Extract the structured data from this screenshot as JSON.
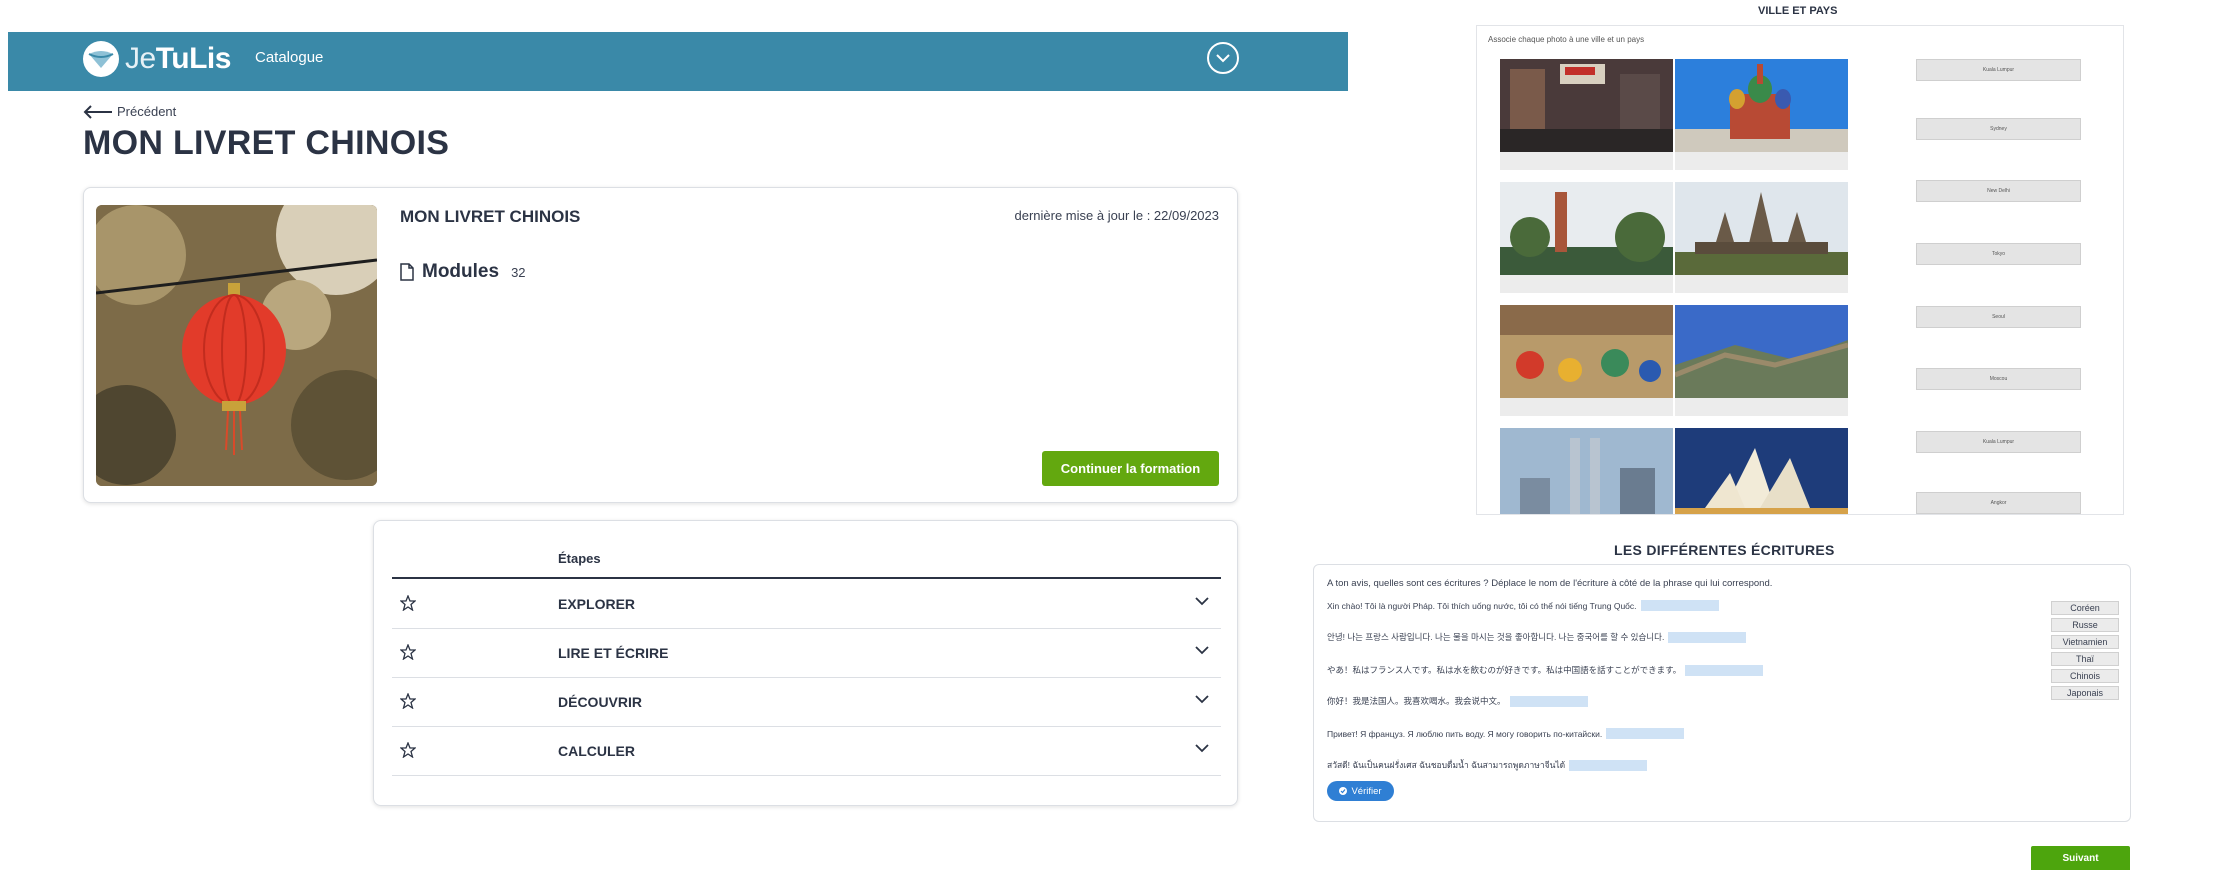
{
  "header": {
    "logo_prefix": "Je",
    "logo_brand": "TuLis",
    "nav_catalogue": "Catalogue",
    "toggle_icon": "chevron-down-circle-icon"
  },
  "page": {
    "back_label": "Précédent",
    "title": "MON LIVRET CHINOIS"
  },
  "course": {
    "name": "MON LIVRET CHINOIS",
    "updated": "dernière mise à jour le : 22/09/2023",
    "modules_label": "Modules",
    "modules_count": "32",
    "continue_label": "Continuer la formation"
  },
  "steps": {
    "header": "Étapes",
    "items": [
      {
        "label": "EXPLORER"
      },
      {
        "label": "LIRE ET ÉCRIRE"
      },
      {
        "label": "DÉCOUVRIR"
      },
      {
        "label": "CALCULER"
      }
    ]
  },
  "ville_pays": {
    "title": "VILLE ET PAYS",
    "instruction": "Associe chaque photo à une ville et un pays",
    "cities": [
      "Kuala Lumpur",
      "Sydney",
      "New Delhi",
      "Tokyo",
      "Seoul",
      "Moscou",
      "Kuala Lumpur",
      "Angkor"
    ]
  },
  "ecritures": {
    "title": "LES DIFFÉRENTES ÉCRITURES",
    "instruction": "A ton avis, quelles sont ces écritures ? Déplace le nom de l'écriture à côté de la phrase qui lui correspond.",
    "sentences": [
      "Xin chào! Tôi là người Pháp. Tôi thích uống nước, tôi có thể nói tiếng Trung Quốc.",
      "안녕! 나는 프랑스 사람입니다. 나는 물을 마시는 것을 좋아합니다. 나는 중국어를 할 수 있습니다.",
      "やあ！私はフランス人です。私は水を飲むのが好きです。私は中国語を話すことができます。",
      "你好！我是法国人。我喜欢喝水。我会说中文。",
      "Привет! Я француз. Я люблю пить воду. Я могу говорить по-китайски.",
      "สวัสดี! ฉันเป็นคนฝรั่งเศส ฉันชอบดื่มน้ำ ฉันสามารถพูดภาษาจีนได้"
    ],
    "chips": [
      "Coréen",
      "Russe",
      "Vietnamien",
      "Thaï",
      "Chinois",
      "Japonais"
    ],
    "verify_label": "Vérifier",
    "next_label": "Suivant"
  },
  "colors": {
    "header_bg": "#3a89a8",
    "continue_bg": "#63a80f",
    "verify_bg": "#2f7fd4",
    "title_text": "#2b3344"
  }
}
